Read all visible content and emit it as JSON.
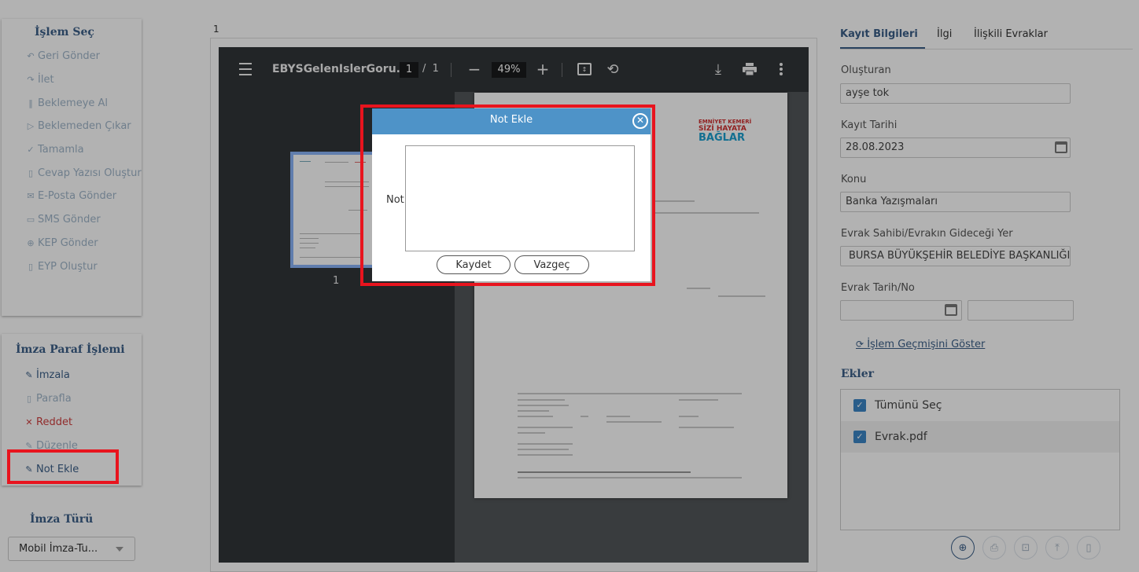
{
  "sidebar": {
    "islem_title": "İşlem Seç",
    "islem_items": [
      {
        "label": "Geri Gönder",
        "icon": "undo-icon"
      },
      {
        "label": "İlet",
        "icon": "forward-icon"
      },
      {
        "label": "Beklemeye Al",
        "icon": "pause-icon"
      },
      {
        "label": "Beklemeden Çıkar",
        "icon": "play-icon"
      },
      {
        "label": "Tamamla",
        "icon": "check-icon"
      },
      {
        "label": "Cevap Yazısı Oluştur",
        "icon": "document-icon"
      },
      {
        "label": "E-Posta Gönder",
        "icon": "envelope-icon"
      },
      {
        "label": "SMS Gönder",
        "icon": "sms-icon"
      },
      {
        "label": "KEP Gönder",
        "icon": "kep-icon"
      },
      {
        "label": "EYP Oluştur",
        "icon": "file-icon"
      }
    ],
    "imza_title": "İmza Paraf İşlemi",
    "imza_items": [
      {
        "label": "İmzala",
        "icon": "pen-icon"
      },
      {
        "label": "Parafla",
        "icon": "document-icon"
      },
      {
        "label": "Reddet",
        "icon": "x-icon"
      },
      {
        "label": "Düzenle",
        "icon": "edit-icon"
      },
      {
        "label": "Not Ekle",
        "icon": "note-edit-icon"
      }
    ],
    "imza_turu_title": "İmza Türü",
    "imza_turu_value": "Mobil İmza-Tu..."
  },
  "viewer": {
    "page_indicator": "1",
    "doc_title": "EBYSGelenIslerGoru...",
    "current_page": "1",
    "page_sep": "/",
    "total_pages": "1",
    "zoom": "49%",
    "thumb_page": "1",
    "doc_logo_line1": "EMNİYET KEMERİ",
    "doc_logo_line2": "SİZİ HAYATA",
    "doc_logo_line3": "BAĞLAR"
  },
  "right": {
    "tabs": [
      "Kayıt Bilgileri",
      "İlgi",
      "İlişkili Evraklar"
    ],
    "olusturan_label": "Oluşturan",
    "olusturan_value": "ayşe tok",
    "kayit_tarihi_label": "Kayıt Tarihi",
    "kayit_tarihi_value": "28.08.2023",
    "konu_label": "Konu",
    "konu_value": "Banka Yazışmaları",
    "sahibi_label": "Evrak Sahibi/Evrakın Gideceği Yer",
    "sahibi_value": "BURSA BÜYÜKŞEHİR BELEDİYE BAŞKANLIĞI",
    "evrak_tarih_label": "Evrak Tarih/No",
    "evrak_tarih_value": "",
    "evrak_no_value": "",
    "gecmis_link": "İşlem Geçmişini Göster",
    "ekler_title": "Ekler",
    "ekler_items": [
      "Tümünü Seç",
      "Evrak.pdf"
    ]
  },
  "modal": {
    "title": "Not Ekle",
    "field_label": "Not",
    "note_value": "",
    "save_label": "Kaydet",
    "cancel_label": "Vazgeç"
  },
  "colors": {
    "accent": "#3b5f88",
    "highlight_red": "#e8141e",
    "modal_header": "#4e93c8"
  }
}
